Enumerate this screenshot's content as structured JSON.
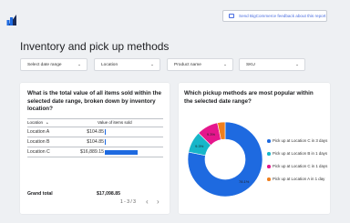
{
  "header": {
    "logo": "bigcommerce-logo-icon",
    "feedback_button": "Send BigCommerce feedback about this report",
    "feedback_icon": "message-icon"
  },
  "page": {
    "title": "Inventory and pick up methods"
  },
  "filters": [
    {
      "label": "Select date range"
    },
    {
      "label": "Location"
    },
    {
      "label": "Product name"
    },
    {
      "label": "SKU"
    }
  ],
  "table_card": {
    "title": "What is the total value of all items sold within the selected date range, broken down by inventory location?",
    "columns": {
      "location": "Location",
      "value": "Value of items sold",
      "sort_indicator": "▲"
    },
    "rows": [
      {
        "location": "Location A",
        "value": "$104.85",
        "fraction": 0.006
      },
      {
        "location": "Location B",
        "value": "$104.85",
        "fraction": 0.006
      },
      {
        "location": "Location C",
        "value": "$16,889.15",
        "fraction": 1.0
      }
    ],
    "grand_total": {
      "label": "Grand total",
      "value": "$17,098.85"
    },
    "pager": {
      "text": "1 - 3 / 3",
      "prev": "‹",
      "next": "›"
    }
  },
  "pie_card": {
    "title": "Which pickup methods are most popular within the selected date range?"
  },
  "chart_data": {
    "type": "pie",
    "title": "Which pickup methods are most popular within the selected date range?",
    "legend_position": "right",
    "slices": [
      {
        "name": "Pick up at Location C in 3 days",
        "value": 78.1,
        "label": "78.1%",
        "color": "#1e6ae0"
      },
      {
        "name": "Pick up at Location B in 1 days",
        "value": 9.3,
        "label": "9.3%",
        "color": "#17b6c9"
      },
      {
        "name": "Pick up at Location C in 1 days",
        "value": 9.3,
        "label": "9.3%",
        "color": "#e5168c"
      },
      {
        "name": "Pick up at Location A in 1 day",
        "value": 3.3,
        "label": "",
        "color": "#f07f1d"
      }
    ]
  }
}
